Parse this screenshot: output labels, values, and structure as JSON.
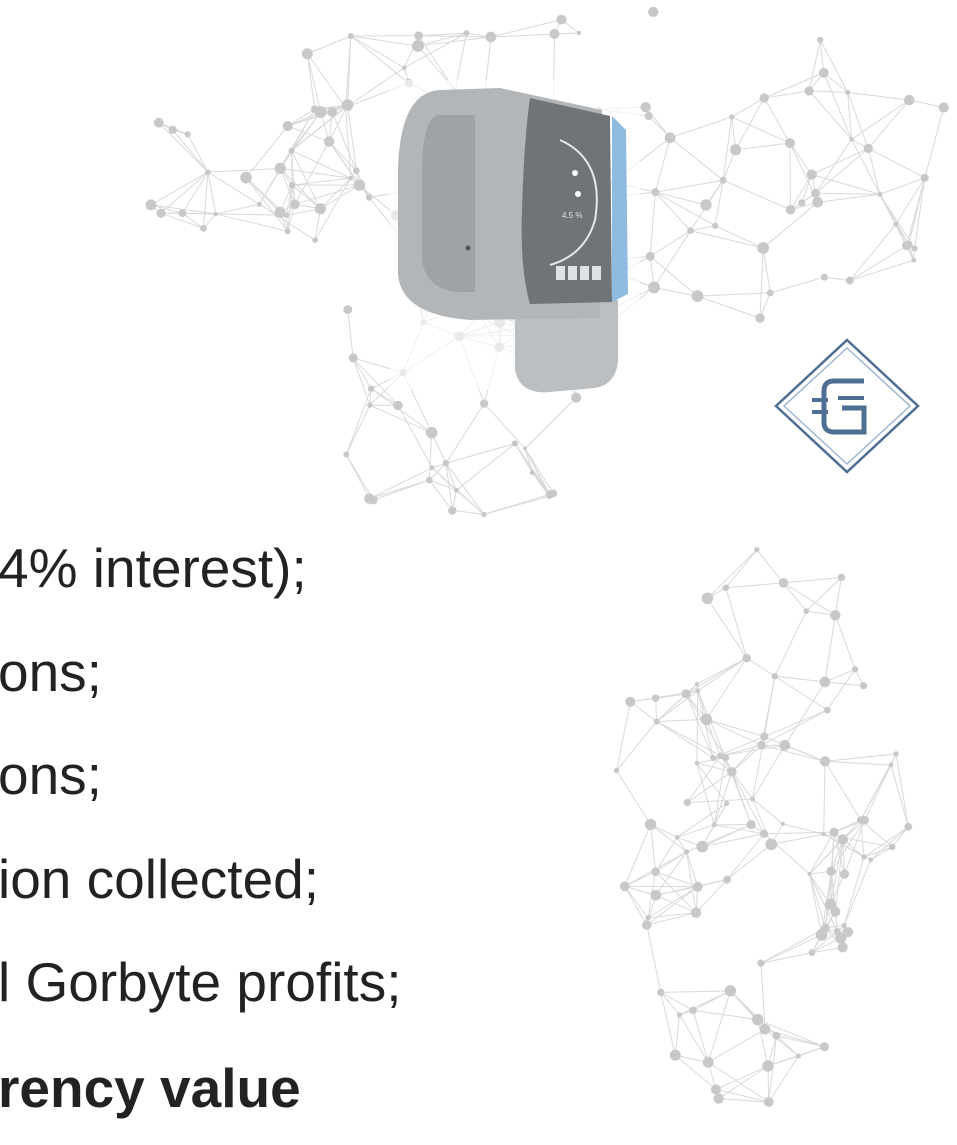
{
  "lines": [
    {
      "text": "4% interest);"
    },
    {
      "text": "ons;"
    },
    {
      "text": "ons;"
    },
    {
      "text": "ion collected;"
    },
    {
      "text": "l Gorbyte profits;"
    },
    {
      "text": "rency value",
      "bold": true
    }
  ],
  "device": {
    "screen_text": "4.5 %"
  },
  "colors": {
    "text": "#222222",
    "network": "#cfcfcf",
    "device_body": "#b9bcbf",
    "device_screen": "#6f7478",
    "logo": "#4e6f93"
  },
  "icons": [
    "world-network-map",
    "flexible-wristband-device",
    "gorbyte-logo-icon"
  ]
}
